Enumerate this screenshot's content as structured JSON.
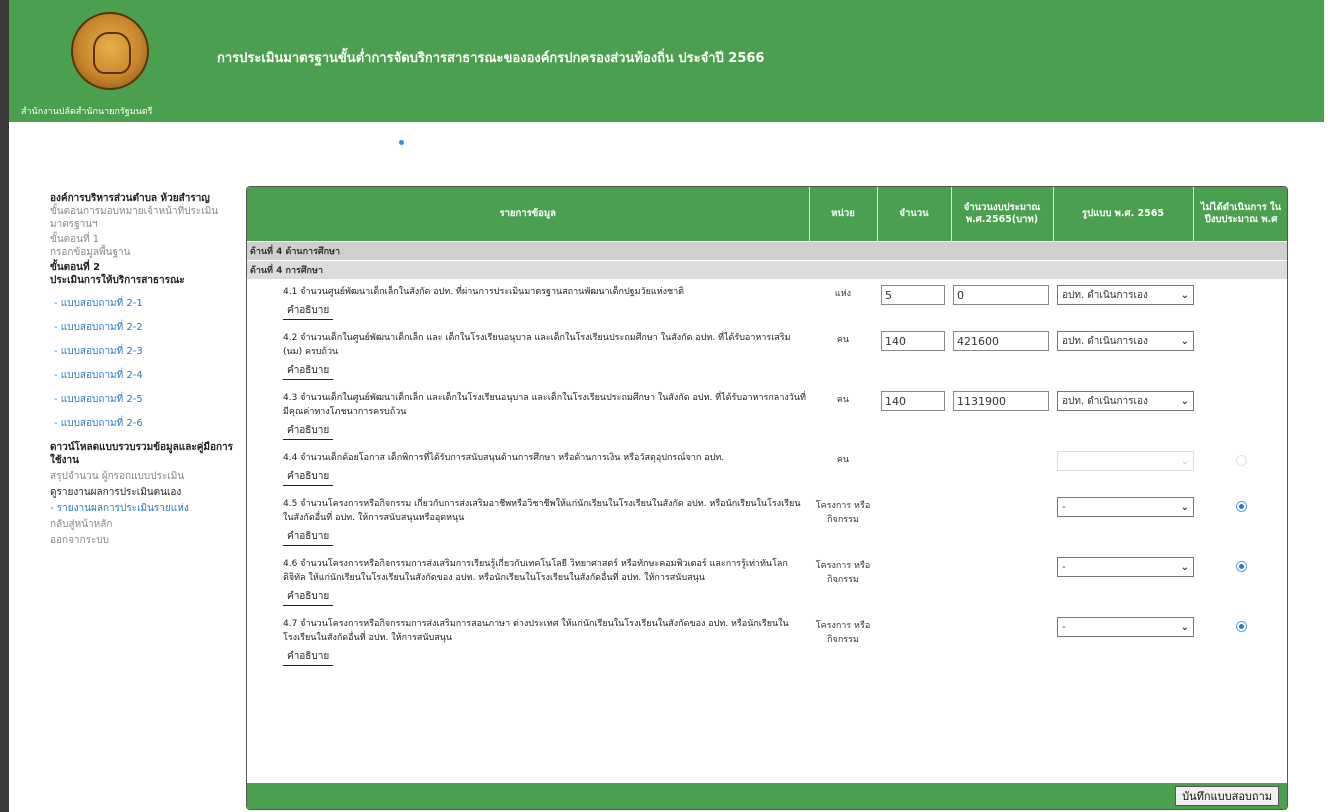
{
  "header": {
    "title": "การประเมินมาตรฐานขั้นต่ำการจัดบริการสาธารณะขององค์กรปกครองส่วนท้องถิ่น ประจำปี 2566",
    "org": "สำนักงานปลัดสำนักนายกรัฐมนตรี"
  },
  "sidebar": {
    "title": "องค์การบริหารส่วนตำบล ห้วยสำราญ",
    "step_assign": "ขั้นตอนการมอบหมายเจ้าหน้าที่ประเมินมาตรฐานฯ",
    "step1": "ขั้นตอนที่ 1",
    "step1_desc": "กรอกข้อมูลพื้นฐาน",
    "step2": "ขั้นตอนที่ 2",
    "step2_desc": "ประเมินการให้บริการสาธารณะ",
    "forms": [
      "- แบบสอบถามที่ 2-1",
      "- แบบสอบถามที่ 2-2",
      "- แบบสอบถามที่ 2-3",
      "- แบบสอบถามที่ 2-4",
      "- แบบสอบถามที่ 2-5",
      "- แบบสอบถามที่ 2-6"
    ],
    "download": "ดาวน์โหลดแบบรวบรวมข้อมูลและคู่มือการใช้งาน",
    "summary": "สรุปจำนวน ผู้กรอกแบบประเมิน",
    "self_report": "ดูรายงานผลการประเมินตนเอง",
    "report_link": "- รายงานผลการประเมินรายแห่ง",
    "home": "กลับสู่หน้าหลัก",
    "logout": "ออกจากระบบ"
  },
  "table": {
    "headers": {
      "item": "รายการข้อมูล",
      "unit": "หน่วย",
      "count": "จำนวน",
      "budget": "จำนวนงบประมาณ พ.ศ.2565(บาท)",
      "format": "รูปแบบ พ.ศ. 2565",
      "not_done": "ไม่ได้ดำเนินการ ในปีงบประมาณ พ.ศ"
    },
    "section": "ด้านที่ 4 ด้านการศึกษา",
    "subsection": "ด้านที่ 4 การศึกษา",
    "explain_label": "คำอธิบาย",
    "rows": [
      {
        "text": "4.1 จำนวนศูนย์พัฒนาเด็กเล็กในสังกัด อปท. ที่ผ่านการประเมินมาตรฐานสถานพัฒนาเด็กปฐมวัยแห่งชาติ",
        "unit": "แห่ง",
        "count": "5",
        "budget": "0",
        "format": "อปท. ดำเนินการเอง",
        "radio": "none"
      },
      {
        "text": "4.2 จำนวนเด็กในศูนย์พัฒนาเด็กเล็ก และ เด็กในโรงเรียนอนุบาล และเด็กในโรงเรียนประถมศึกษา ในสังกัด อปท. ที่ได้รับอาหารเสริม (นม) ครบถ้วน",
        "unit": "คน",
        "count": "140",
        "budget": "421600",
        "format": "อปท. ดำเนินการเอง",
        "radio": "none"
      },
      {
        "text": "4.3 จำนวนเด็กในศูนย์พัฒนาเด็กเล็ก และเด็กในโรงเรียนอนุบาล และเด็กในโรงเรียนประถมศึกษา ในสังกัด อปท. ที่ได้รับอาหารกลางวันที่มีคุณค่าทางโภชนาการครบถ้วน",
        "unit": "คน",
        "count": "140",
        "budget": "1131900",
        "format": "อปท. ดำเนินการเอง",
        "radio": "none"
      },
      {
        "text": "4.4 จำนวนเด็กด้อยโอกาส เด็กพิการที่ได้รับการสนับสนุนด้านการศึกษา หรือด้านการเงิน หรือวัสดุอุปกรณ์จาก อปท.",
        "unit": "คน",
        "count": "",
        "budget": "",
        "format": "",
        "radio": "dim"
      },
      {
        "text": "4.5 จำนวนโครงการหรือกิจกรรม เกี่ยวกับการส่งเสริมอาชีพหรือวิชาชีพให้แก่นักเรียนในโรงเรียนในสังกัด อปท. หรือนักเรียนในโรงเรียนในสังกัดอื่นที่ อปท. ให้การสนับสนุนหรืออุดหนุน",
        "unit": "โครงการ หรือ กิจกรรม",
        "count": "",
        "budget": "",
        "format": "-",
        "radio": "on"
      },
      {
        "text": "4.6 จำนวนโครงการหรือกิจกรรมการส่งเสริมการเรียนรู้เกี่ยวกับเทคโนโลยี วิทยาศาสตร์ หรือทักษะคอมพิวเตอร์ และการรู้เท่าทันโลกดิจิทัล ให้แก่นักเรียนในโรงเรียนในสังกัดของ อปท. หรือนักเรียนในโรงเรียนในสังกัดอื่นที่ อปท. ให้การสนับสนุน",
        "unit": "โครงการ หรือ กิจกรรม",
        "count": "",
        "budget": "",
        "format": "-",
        "radio": "on"
      },
      {
        "text": "4.7 จำนวนโครงการหรือกิจกรรมการส่งเสริมการสอนภาษา ต่างประเทศ ให้แก่นักเรียนในโรงเรียนในสังกัดของ อปท. หรือนักเรียนในโรงเรียนในสังกัดอื่นที่ อปท. ให้การสนับสนุน",
        "unit": "โครงการ หรือ กิจกรรม",
        "count": "",
        "budget": "",
        "format": "-",
        "radio": "on"
      }
    ],
    "save_label": "บันทึกแบบสอบถาม"
  },
  "colors": {
    "header_green": "#4aa04e",
    "link_blue": "#2a79c9",
    "section_gray": "#cfcfcf"
  },
  "icons": {
    "seal": "government-seal-icon",
    "dropdown": "chevron-down-icon"
  }
}
